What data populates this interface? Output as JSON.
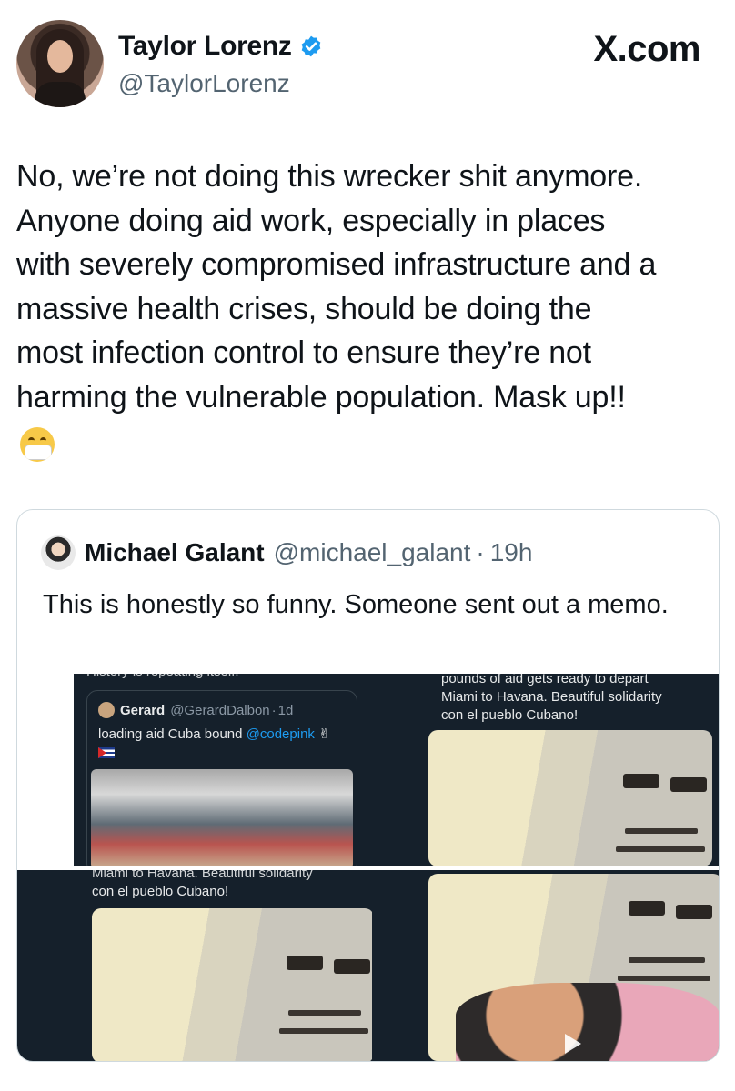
{
  "author": {
    "name": "Taylor Lorenz",
    "handle": "@TaylorLorenz",
    "verified": true
  },
  "brand": "X.com",
  "post": {
    "text": "No, we’re not doing this wrecker shit anymore.\nAnyone doing aid work, especially in places\nwith severely compromised infrastructure and a\nmassive health crises, should be doing the\nmost infection control to ensure they’re not\nharming the vulnerable population. Mask up!!",
    "emoji": "face-with-medical-mask-icon"
  },
  "quote": {
    "name": "Michael Galant",
    "handle": "@michael_galant",
    "separator": "·",
    "time": "19h",
    "text": "This is honestly so funny. Someone sent out a memo.",
    "media": {
      "tile1": {
        "top_caption": "History is repeating itself.",
        "inner": {
          "name": "Gerard",
          "handle": "@GerardDalbon",
          "separator": "·",
          "time": "1d",
          "text": "loading aid Cuba bound",
          "mention": "@codepink",
          "emoji": "victory-hand-icon"
        }
      },
      "tile2": {
        "caption_line1": "pounds of aid gets ready to depart",
        "caption_line2": "Miami to Havana. Beautiful solidarity",
        "caption_line3": "con el pueblo Cubano!"
      },
      "tile3": {
        "caption_line1": "Miami to Havana. Beautiful solidarity",
        "caption_line2": "con el pueblo Cubano!"
      }
    }
  },
  "colors": {
    "verified_blue": "#1d9bf0",
    "secondary_text": "#536471",
    "dark_tile": "#15202b"
  }
}
